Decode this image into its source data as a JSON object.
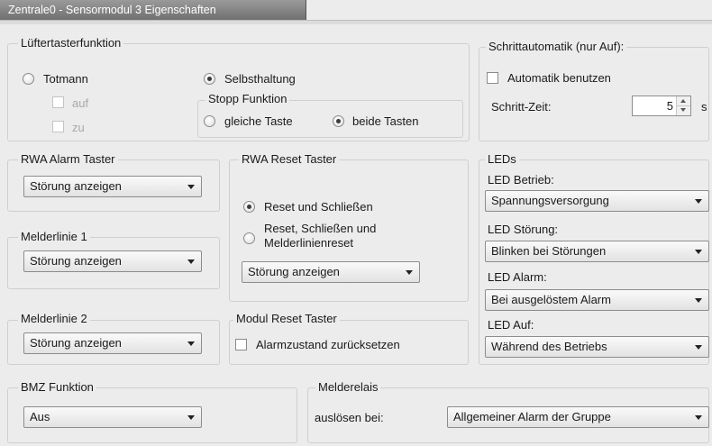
{
  "window": {
    "title": "Zentrale0 - Sensormodul 3 Eigenschaften"
  },
  "luefter": {
    "legend": "Lüftertasterfunktion",
    "totmann_label": "Totmann",
    "selbsthaltung_label": "Selbsthaltung",
    "auf_label": "auf",
    "zu_label": "zu",
    "stopp": {
      "legend": "Stopp Funktion",
      "gleiche_label": "gleiche Taste",
      "beide_label": "beide Tasten"
    }
  },
  "schritt": {
    "legend": "Schrittautomatik (nur Auf):",
    "auto_label": "Automatik benutzen",
    "zeit_label": "Schritt-Zeit:",
    "zeit_value": "5",
    "unit": "s"
  },
  "rwa_alarm": {
    "legend": "RWA Alarm Taster",
    "value": "Störung anzeigen"
  },
  "melder1": {
    "legend": "Melderlinie 1",
    "value": "Störung anzeigen"
  },
  "melder2": {
    "legend": "Melderlinie 2",
    "value": "Störung anzeigen"
  },
  "rwa_reset": {
    "legend": "RWA Reset Taster",
    "opt1": "Reset und Schließen",
    "opt2_line1": "Reset, Schließen und",
    "opt2_line2": "Melderlinienreset",
    "value": "Störung anzeigen"
  },
  "modul_reset": {
    "legend": "Modul Reset Taster",
    "check_label": "Alarmzustand zurücksetzen"
  },
  "leds": {
    "legend": "LEDs",
    "betrieb_label": "LED Betrieb:",
    "betrieb_value": "Spannungsversorgung",
    "stoerung_label": "LED Störung:",
    "stoerung_value": "Blinken bei Störungen",
    "alarm_label": "LED Alarm:",
    "alarm_value": "Bei ausgelöstem Alarm",
    "auf_label": "LED Auf:",
    "auf_value": "Während des Betriebs"
  },
  "bmz": {
    "legend": "BMZ Funktion",
    "value": "Aus"
  },
  "melderelais": {
    "legend": "Melderelais",
    "label": "auslösen bei:",
    "value": "Allgemeiner Alarm der Gruppe"
  }
}
